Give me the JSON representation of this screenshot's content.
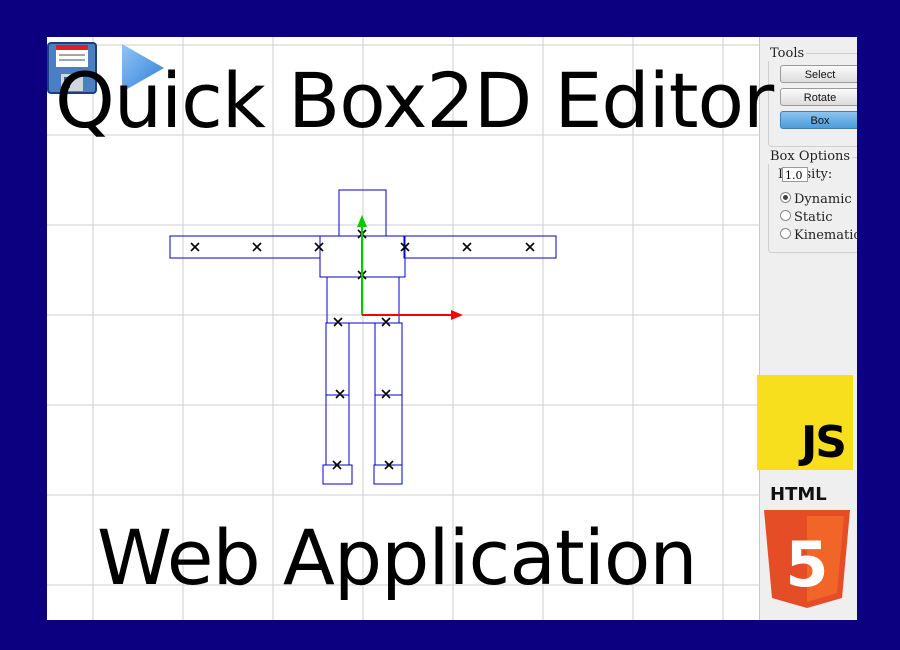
{
  "title": {
    "top": "Quick Box2D Editor",
    "bottom": "Web Application"
  },
  "toolbar": {
    "save_icon": "save-icon",
    "play_icon": "play-icon"
  },
  "tools": {
    "legend": "Tools",
    "buttons": [
      {
        "label": "Select",
        "active": false
      },
      {
        "label": "Rotate",
        "active": false
      },
      {
        "label": "Box",
        "active": true
      }
    ]
  },
  "box_options": {
    "legend": "Box Options",
    "density_label": "Density:",
    "density_value": "1.0",
    "body_types": [
      {
        "label": "Dynamic",
        "checked": true
      },
      {
        "label": "Static",
        "checked": false
      },
      {
        "label": "Kinematic",
        "checked": false
      }
    ]
  },
  "logos": {
    "js": "JS",
    "html": "HTML",
    "html5_digit": "5"
  },
  "colors": {
    "background": "#0d0080",
    "box_outline": "#0000cc",
    "axis_x": "#ff0000",
    "axis_y": "#00cc00",
    "js_yellow": "#f7df1e",
    "html5_orange": "#e44d26"
  }
}
